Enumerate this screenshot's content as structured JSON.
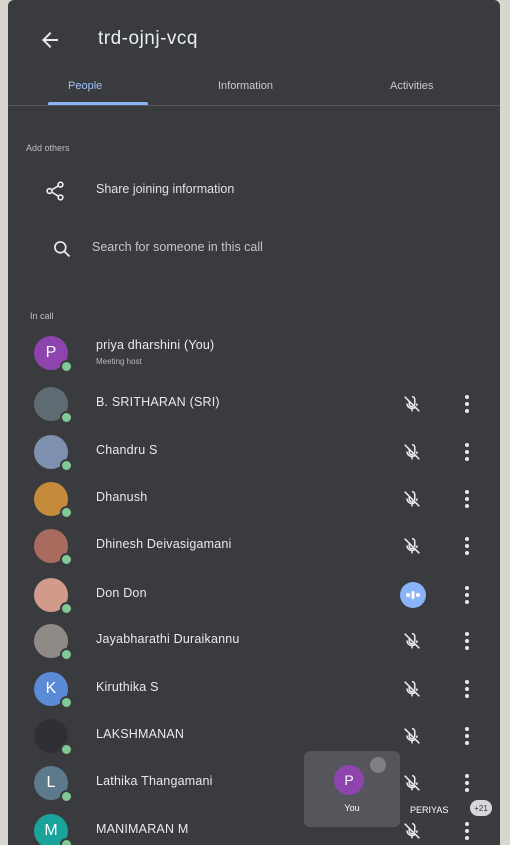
{
  "header": {
    "title": "trd-ojnj-vcq",
    "back_icon": "arrow-left-icon"
  },
  "tabs": [
    {
      "label": "People",
      "active": true
    },
    {
      "label": "Information",
      "active": false
    },
    {
      "label": "Activities",
      "active": false
    }
  ],
  "add_others": {
    "section_label": "Add others",
    "share_label": "Share joining information",
    "share_icon": "share-icon",
    "search_label": "Search for someone in this call",
    "search_icon": "search-icon"
  },
  "in_call": {
    "section_label": "In call",
    "participants": [
      {
        "name": "priya dharshini (You)",
        "subtitle": "Meeting host",
        "initial": "P",
        "avatar_color": "#8e44ad",
        "mic": "none"
      },
      {
        "name": "B. SRITHARAN (SRI)",
        "initial": "",
        "avatar_color": "#5f6b73",
        "mic": "muted"
      },
      {
        "name": "Chandru S",
        "initial": "",
        "avatar_color": "#7f8fb0",
        "mic": "muted"
      },
      {
        "name": "Dhanush",
        "initial": "",
        "avatar_color": "#c58a3a",
        "mic": "muted"
      },
      {
        "name": "Dhinesh Deivasigamani",
        "initial": "",
        "avatar_color": "#a86b5e",
        "mic": "muted"
      },
      {
        "name": "Don Don",
        "initial": "",
        "avatar_color": "#d19a8a",
        "mic": "speaking"
      },
      {
        "name": "Jayabharathi Duraikannu",
        "initial": "",
        "avatar_color": "#8f8a86",
        "mic": "muted"
      },
      {
        "name": "Kiruthika S",
        "initial": "K",
        "avatar_color": "#5b8ad6",
        "mic": "muted"
      },
      {
        "name": "LAKSHMANAN",
        "initial": "",
        "avatar_color": "#2e3033",
        "mic": "muted"
      },
      {
        "name": "Lathika Thangamani",
        "initial": "L",
        "avatar_color": "#5d7a8c",
        "mic": "muted"
      },
      {
        "name": "MANIMARAN M",
        "initial": "M",
        "avatar_color": "#1aa39a",
        "mic": "muted"
      }
    ]
  },
  "self_tile": {
    "initial": "P",
    "label": "You"
  },
  "second_tile": {
    "label": "PERIYAS",
    "badge": "+21"
  },
  "colors": {
    "background": "#3a3b3f",
    "accent": "#8ab4f8",
    "online": "#81c995"
  }
}
